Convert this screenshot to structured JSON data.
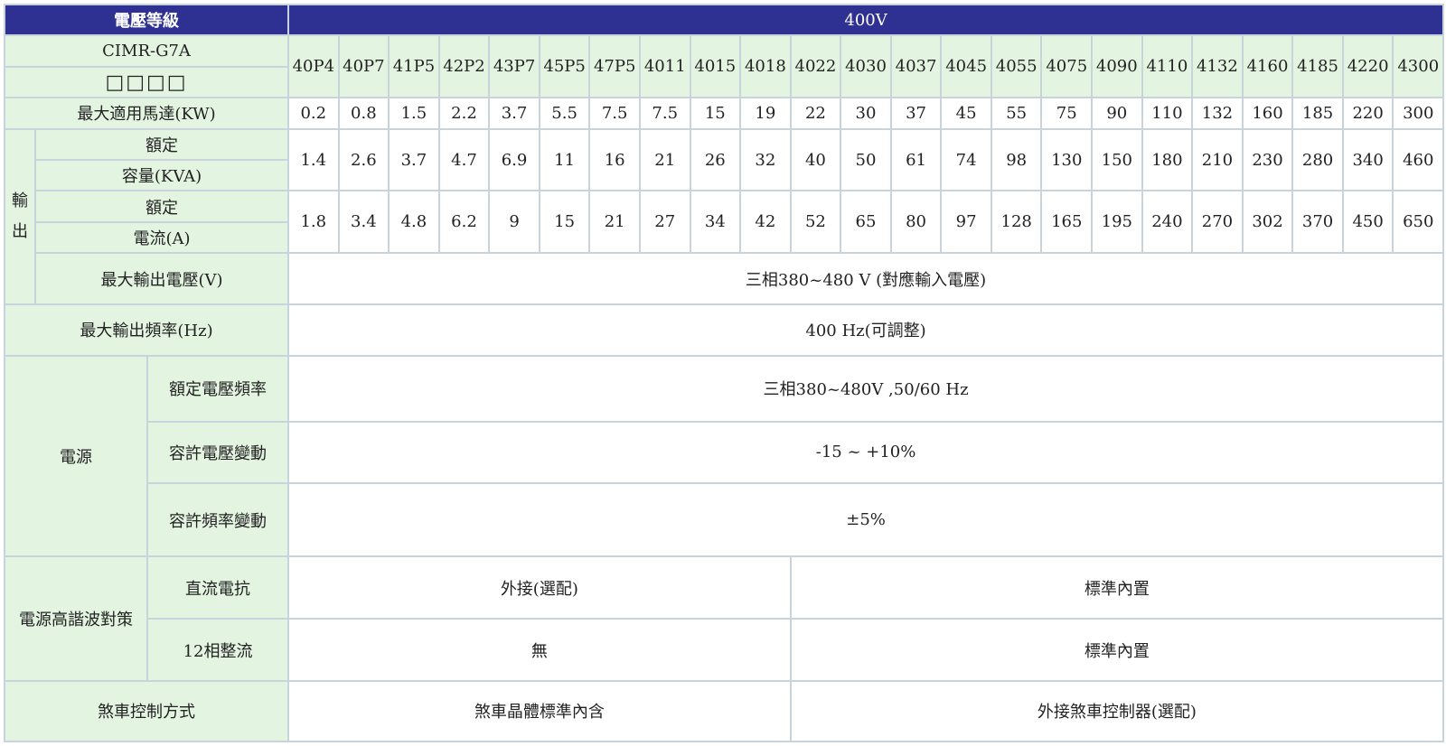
{
  "header": {
    "label": "電壓等級",
    "value": "400V"
  },
  "model": {
    "label": "CIMR-G7A",
    "placeholder": "□□□□",
    "codes": [
      "40P4",
      "40P7",
      "41P5",
      "42P2",
      "43P7",
      "45P5",
      "47P5",
      "4011",
      "4015",
      "4018",
      "4022",
      "4030",
      "4037",
      "4045",
      "4055",
      "4075",
      "4090",
      "4110",
      "4132",
      "4160",
      "4185",
      "4220",
      "4300"
    ]
  },
  "max_motor": {
    "label": "最大適用馬達(KW)",
    "values": [
      "0.2",
      "0.8",
      "1.5",
      "2.2",
      "3.7",
      "5.5",
      "7.5",
      "7.5",
      "15",
      "19",
      "22",
      "30",
      "37",
      "45",
      "55",
      "75",
      "90",
      "110",
      "132",
      "160",
      "185",
      "220",
      "300"
    ]
  },
  "output": {
    "group_label": "輸出",
    "capacity": {
      "label_line1": "額定",
      "label_line2": "容量(KVA)",
      "values": [
        "1.4",
        "2.6",
        "3.7",
        "4.7",
        "6.9",
        "11",
        "16",
        "21",
        "26",
        "32",
        "40",
        "50",
        "61",
        "74",
        "98",
        "130",
        "150",
        "180",
        "210",
        "230",
        "280",
        "340",
        "460"
      ]
    },
    "current": {
      "label_line1": "額定",
      "label_line2": "電流(A)",
      "values": [
        "1.8",
        "3.4",
        "4.8",
        "6.2",
        "9",
        "15",
        "21",
        "27",
        "34",
        "42",
        "52",
        "65",
        "80",
        "97",
        "128",
        "165",
        "195",
        "240",
        "270",
        "302",
        "370",
        "450",
        "650"
      ]
    },
    "max_voltage": {
      "label": "最大輸出電壓(V)",
      "value": "三相380~480 V (對應輸入電壓)"
    }
  },
  "max_frequency": {
    "label": "最大輸出頻率(Hz)",
    "value": "400 Hz(可調整)"
  },
  "power": {
    "group_label": "電源",
    "rated": {
      "label": "額定電壓頻率",
      "value": "三相380~480V ,50/60 Hz"
    },
    "voltage_tolerance": {
      "label": "容許電壓變動",
      "value": "-15 ~ +10%"
    },
    "frequency_tolerance": {
      "label": "容許頻率變動",
      "value": "±5%"
    }
  },
  "harmonics": {
    "group_label": "電源高諧波對策",
    "dc_reactor": {
      "label": "直流電抗",
      "value_left": "外接(選配)",
      "value_right": "標準內置"
    },
    "rectifier": {
      "label": "12相整流",
      "value_left": "無",
      "value_right": "標準內置"
    }
  },
  "braking": {
    "label": "煞車控制方式",
    "value_left": "煞車晶體標準內含",
    "value_right": "外接煞車控制器(選配)"
  }
}
